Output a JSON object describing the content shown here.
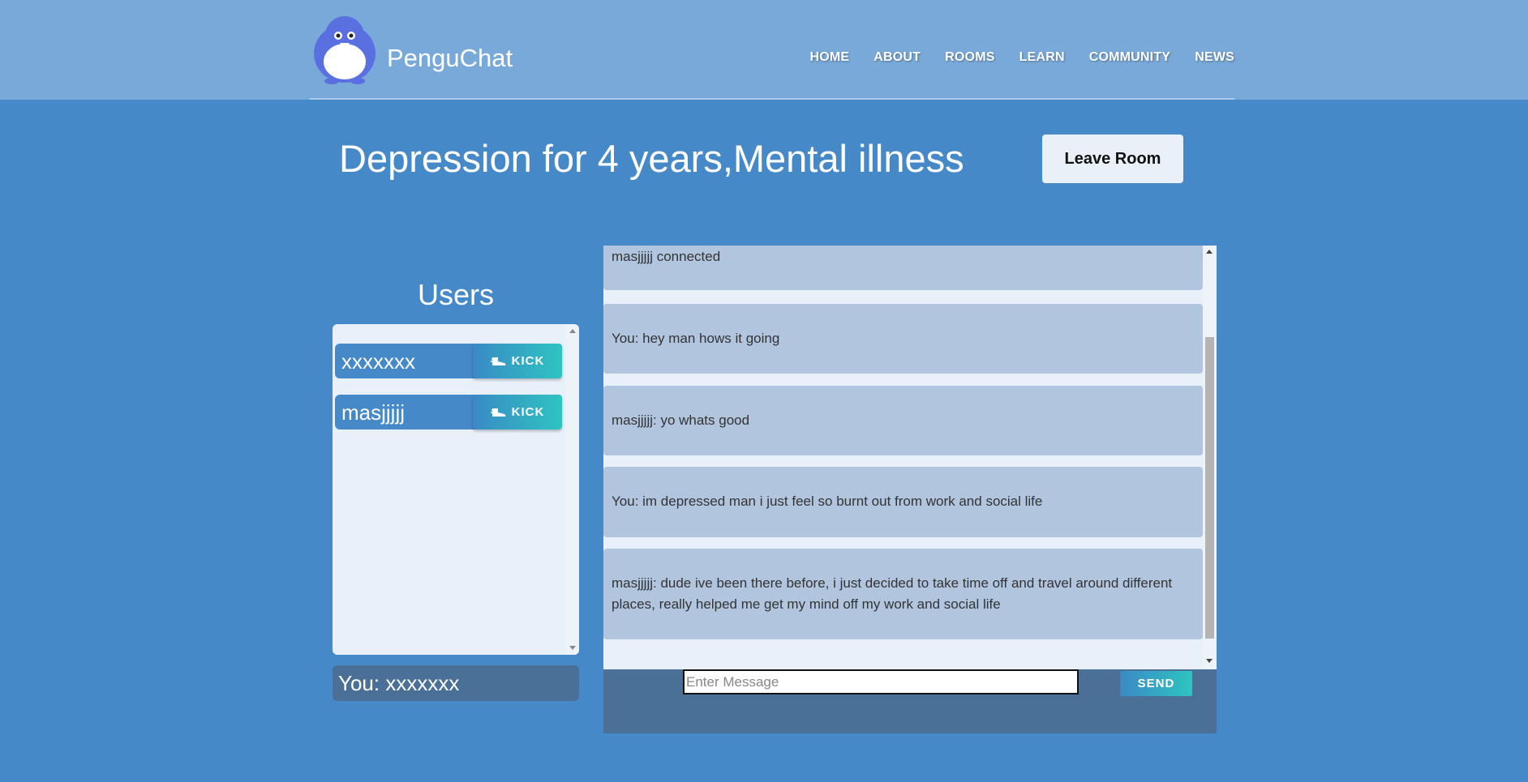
{
  "header": {
    "brand": "PenguChat",
    "nav": [
      "HOME",
      "ABOUT",
      "ROOMS",
      "LEARN",
      "COMMUNITY",
      "NEWS"
    ]
  },
  "room": {
    "title": "Depression for 4 years,Mental illness",
    "leave_label": "Leave Room"
  },
  "users": {
    "title": "Users",
    "list": [
      {
        "name": "xxxxxxx",
        "action": "KICK"
      },
      {
        "name": "masjjjjj",
        "action": "KICK"
      }
    ],
    "you_label": "You: xxxxxxx"
  },
  "chat": {
    "messages": [
      "masjjjjj connected",
      "You: hey man hows it going",
      "masjjjjj: yo whats good",
      "You: im depressed man i just feel so burnt out from work and social life",
      "masjjjjj: dude ive been there before, i just decided to take time off and travel around different places, really helped me get my mind off my work and social life"
    ],
    "input_placeholder": "Enter Message",
    "send_label": "SEND"
  },
  "icons": {
    "logo": "penguin-logo-icon",
    "kick": "boot-icon"
  },
  "colors": {
    "background": "#4589c9",
    "navbar": "#79a9d9",
    "panel": "#e8f0f9",
    "message": "#b1c5df",
    "accent_gradient_start": "#3a8ac6",
    "accent_gradient_end": "#2ec4c0",
    "dark_bar": "#4b7097"
  }
}
